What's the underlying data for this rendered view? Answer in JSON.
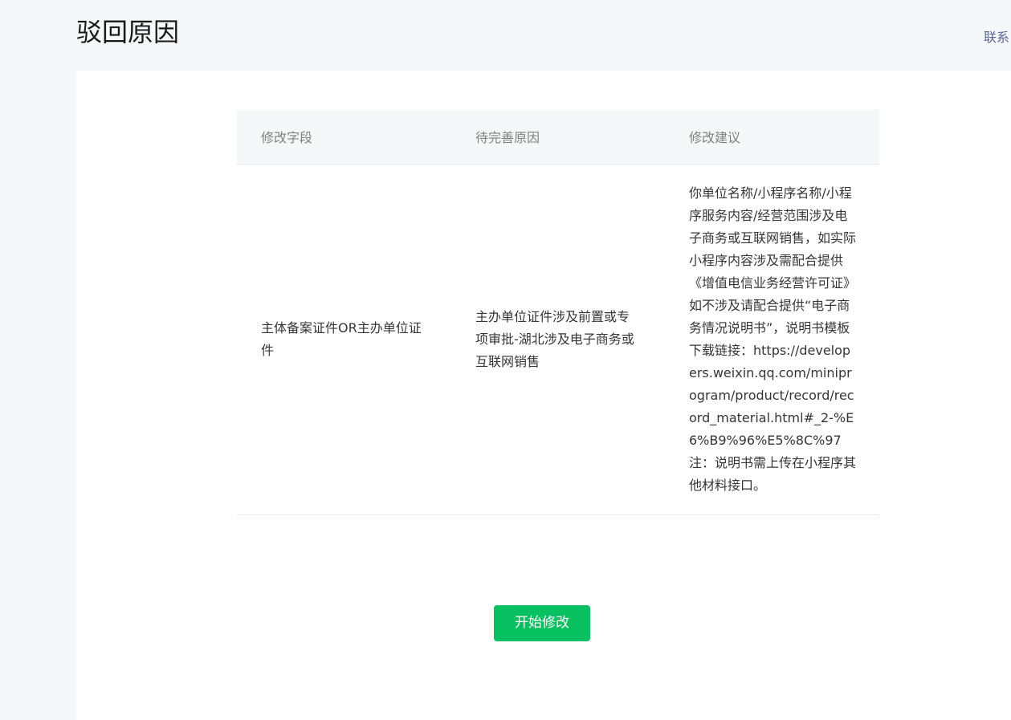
{
  "page": {
    "title": "驳回原因",
    "contact_link": "联系"
  },
  "table": {
    "headers": [
      "修改字段",
      "待完善原因",
      "修改建议"
    ],
    "rows": [
      {
        "field": "主体备案证件OR主办单位证件",
        "reason": "主办单位证件涉及前置或专项审批-湖北涉及电子商务或互联网销售",
        "advice": "你单位名称/小程序名称/小程序服务内容/经营范围涉及电子商务或互联网销售，如实际小程序内容涉及需配合提供《增值电信业务经营许可证》如不涉及请配合提供“电子商务情况说明书”，说明书模板下载链接：https://developers.weixin.qq.com/miniprogram/product/record/record_material.html#_2-%E6%B9%96%E5%8C%97\n注：说明书需上传在小程序其他材料接口。"
      }
    ]
  },
  "actions": {
    "start_label": "开始修改"
  },
  "colors": {
    "background": "#f6f7f9",
    "card": "#ffffff",
    "primary_button": "#07c160",
    "link": "#576b95"
  }
}
